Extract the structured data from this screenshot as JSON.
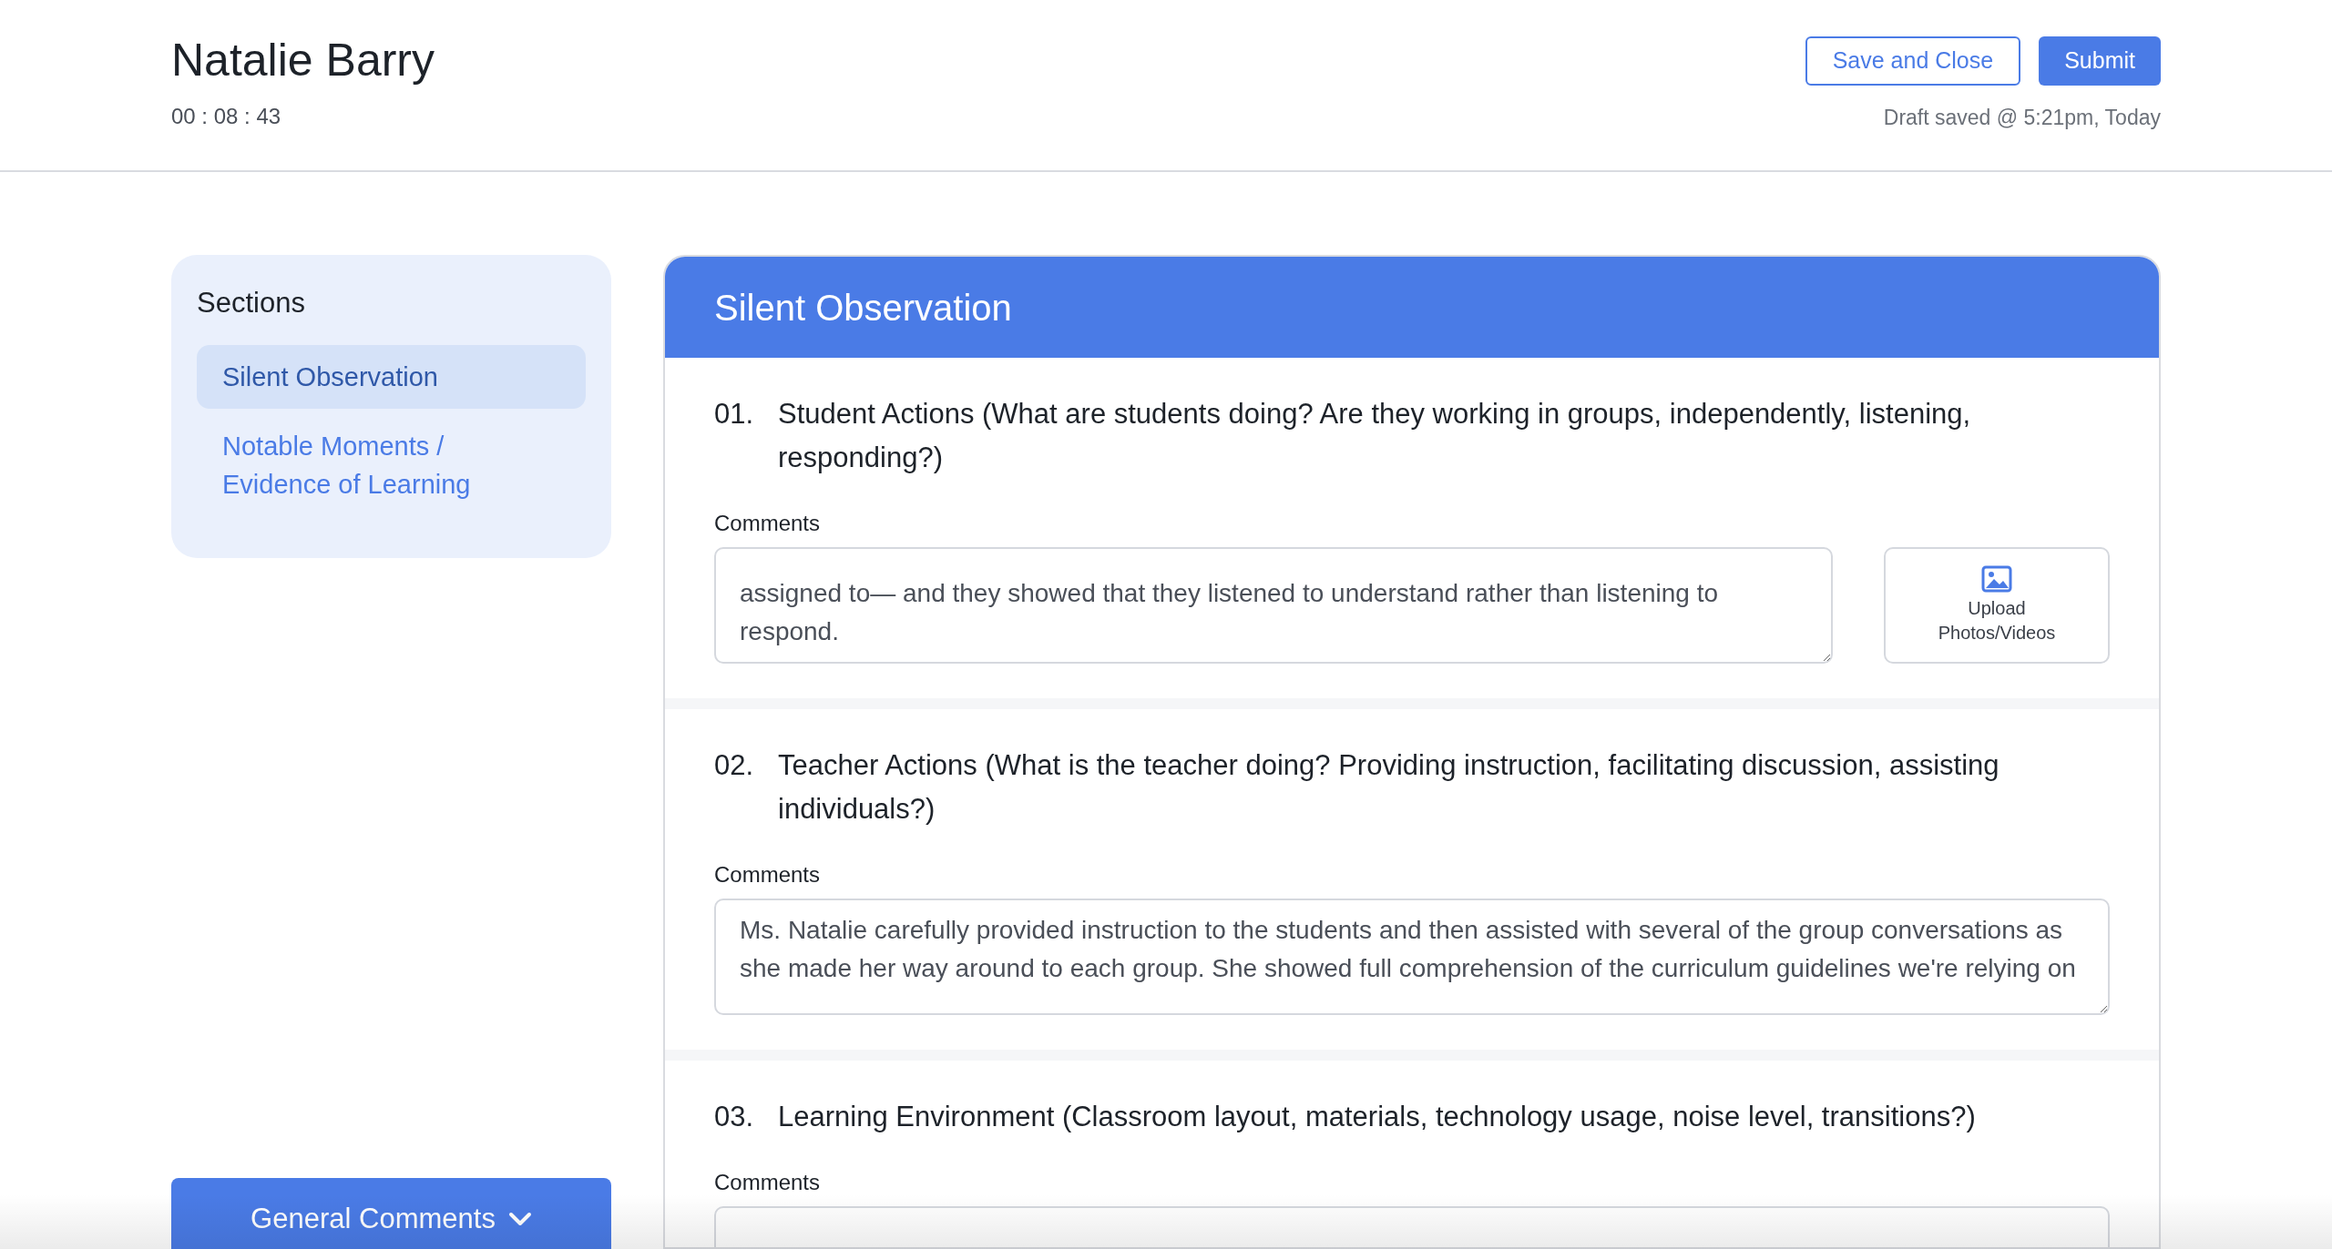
{
  "header": {
    "name": "Natalie Barry",
    "timer": "00 : 08 : 43",
    "buttons": [
      {
        "label": "Save and Close",
        "kind": "outline"
      },
      {
        "label": "Submit",
        "kind": "primary"
      }
    ],
    "draft_status": "Draft saved @ 5:21pm, Today"
  },
  "sidebar": {
    "title": "Sections",
    "items": [
      {
        "label": "Silent Observation",
        "selected": true
      },
      {
        "label": "Notable Moments / Evidence of Learning",
        "selected": false
      }
    ],
    "general_comments": {
      "label": "General Comments"
    }
  },
  "section": {
    "title": "Silent Observation",
    "questions": [
      {
        "number": "01.",
        "text": "Student Actions (What are students doing? Are they working in groups, independently, listening, responding?)",
        "comments_label": "Comments",
        "value": "assigned to— and they showed that they listened to understand rather than listening to respond.",
        "upload": {
          "label": "Upload Photos/Videos"
        }
      },
      {
        "number": "02.",
        "text": "Teacher Actions (What is the teacher doing? Providing instruction, facilitating discussion, assisting individuals?)",
        "comments_label": "Comments",
        "value": "Ms. Natalie carefully provided instruction to the students and then assisted with several of the group conversations as she made her way around to each group. She showed full comprehension of the curriculum guidelines we're relying on"
      },
      {
        "number": "03.",
        "text": "Learning Environment (Classroom layout, materials, technology usage, noise level, transitions?)",
        "comments_label": "Comments"
      }
    ]
  }
}
